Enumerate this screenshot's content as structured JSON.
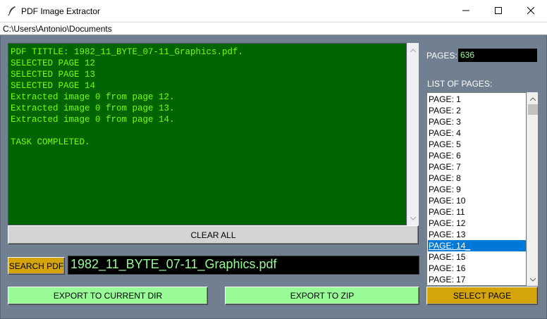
{
  "window": {
    "title": "PDF Image Extractor",
    "path": "C:\\Users\\Antonio\\Documents"
  },
  "log": {
    "lines": [
      "PDF TITTLE: 1982_11_BYTE_07-11_Graphics.pdf.",
      "SELECTED PAGE 12",
      "SELECTED PAGE 13",
      "SELECTED PAGE 14",
      "Extracted image 0 from page 12.",
      "Extracted image 0 from page 13.",
      "Extracted image 0 from page 14.",
      "",
      "TASK COMPLETED."
    ]
  },
  "buttons": {
    "clear_all": "CLEAR ALL",
    "search_pdf": "SEARCH PDF",
    "export_current_dir": "EXPORT TO CURRENT DIR",
    "export_zip": "EXPORT TO ZIP",
    "select_page": "SELECT PAGE"
  },
  "file": {
    "name": "1982_11_BYTE_07-11_Graphics.pdf"
  },
  "pages": {
    "label": "PAGES:",
    "count": "636"
  },
  "page_list": {
    "label": "LIST OF PAGES:",
    "items": [
      "PAGE: 1",
      "PAGE: 2",
      "PAGE: 3",
      "PAGE: 4",
      "PAGE: 5",
      "PAGE: 6",
      "PAGE: 7",
      "PAGE: 8",
      "PAGE: 9",
      "PAGE: 10",
      "PAGE: 11",
      "PAGE: 12",
      "PAGE: 13",
      "PAGE: 14_",
      "PAGE: 15",
      "PAGE: 16",
      "PAGE: 17"
    ],
    "selected_index": 13
  },
  "colors": {
    "background": "#708090",
    "log_bg": "#006400",
    "log_text": "#7cfc00",
    "accent_gold": "#d4a40a",
    "accent_green": "#98fb98",
    "selection": "#0078d7"
  },
  "icons": {
    "app": "feather-icon",
    "minimize": "minimize-icon",
    "maximize": "maximize-icon",
    "close": "close-icon",
    "scroll_up": "scroll-up-arrow-icon",
    "scroll_down": "scroll-down-arrow-icon"
  }
}
